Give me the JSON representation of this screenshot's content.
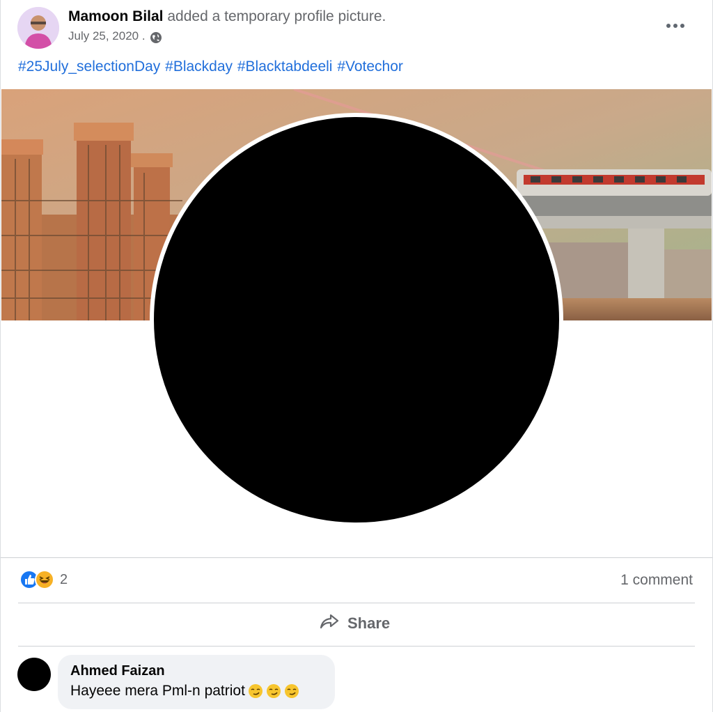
{
  "post": {
    "author_name": "Mamoon Bilal",
    "action_text": "added a temporary profile picture.",
    "date": "July 25, 2020 .",
    "privacy_icon": "globe-icon",
    "more_icon": "more-options-icon",
    "hashtags": [
      "#25July_selectionDay",
      "#Blackday",
      "#Blacktabdeeli",
      "#Votechor"
    ]
  },
  "reactions": {
    "icons": [
      "like-icon",
      "haha-icon"
    ],
    "count": "2"
  },
  "comments_count": "1 comment",
  "actions": {
    "share_label": "Share",
    "share_icon": "share-arrow-icon"
  },
  "comment": {
    "author": "Ahmed Faizan",
    "text": "Hayeee mera Pml-n patriot",
    "emoji_icons": [
      "smirk-face-icon",
      "smirk-face-icon",
      "smirk-face-icon"
    ]
  },
  "colors": {
    "link_blue": "#216fdb",
    "secondary_text": "#65676b",
    "like_blue": "#1877f2",
    "haha_yellow": "#f7b125",
    "comment_bg": "#f0f2f5"
  }
}
